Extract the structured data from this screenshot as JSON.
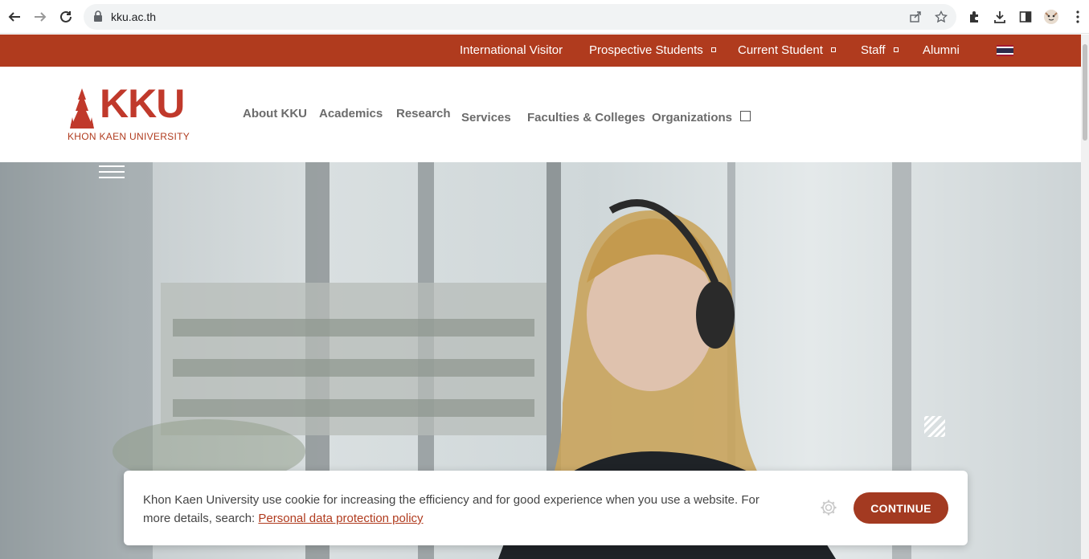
{
  "browser": {
    "url": "kku.ac.th",
    "icons": [
      "back-icon",
      "forward-icon",
      "reload-icon",
      "lock-icon",
      "share-icon",
      "star-icon",
      "extensions-icon",
      "download-icon",
      "side-panel-icon",
      "profile-avatar",
      "menu-icon"
    ]
  },
  "colors": {
    "brand": "#b03b1e",
    "button": "#a33a21"
  },
  "topbar": {
    "items": [
      {
        "label": "International Visitor",
        "has_dropdown": false
      },
      {
        "label": "Prospective Students",
        "has_dropdown": true
      },
      {
        "label": "Current Student",
        "has_dropdown": true
      },
      {
        "label": "Staff",
        "has_dropdown": true
      },
      {
        "label": "Alumni",
        "has_dropdown": false
      }
    ],
    "language_icon": "thai-flag-icon"
  },
  "logo": {
    "letters": "KKU",
    "subtitle": "KHON KAEN UNIVERSITY"
  },
  "mainnav": {
    "items": [
      "About KKU",
      "Academics",
      "Research",
      "Services",
      "Faculties & Colleges",
      "Organizations"
    ]
  },
  "cookie": {
    "text": "Khon Kaen University use cookie for increasing the efficiency and for good experience when you use a website. For more details, search: ",
    "link": "Personal data protection policy",
    "button": "CONTINUE"
  }
}
